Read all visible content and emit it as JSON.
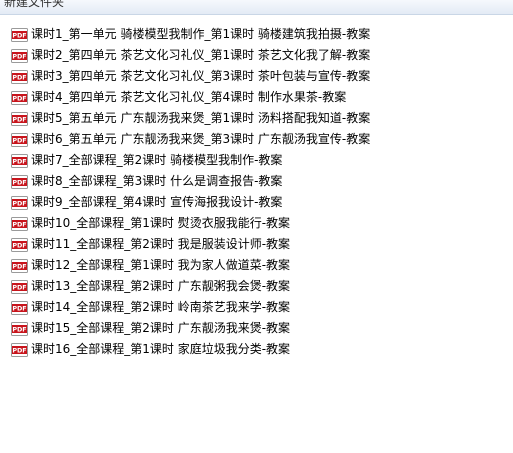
{
  "window": {
    "header_label": "新建文件夹"
  },
  "icons": {
    "file_icon": "pdf-icon",
    "pdf_badge_text": "PDF",
    "pdf_badge_color": "#c8141c"
  },
  "files": [
    {
      "name": "课时1_第一单元 骑楼模型我制作_第1课时 骑楼建筑我拍摄-教案"
    },
    {
      "name": "课时2_第四单元 茶艺文化习礼仪_第1课时 茶艺文化我了解-教案"
    },
    {
      "name": "课时3_第四单元 茶艺文化习礼仪_第3课时 茶叶包装与宣传-教案"
    },
    {
      "name": "课时4_第四单元 茶艺文化习礼仪_第4课时 制作水果茶-教案"
    },
    {
      "name": "课时5_第五单元 广东靓汤我来煲_第1课时 汤料搭配我知道-教案"
    },
    {
      "name": "课时6_第五单元 广东靓汤我来煲_第3课时 广东靓汤我宣传-教案"
    },
    {
      "name": "课时7_全部课程_第2课时 骑楼模型我制作-教案"
    },
    {
      "name": "课时8_全部课程_第3课时 什么是调查报告-教案"
    },
    {
      "name": "课时9_全部课程_第4课时 宣传海报我设计-教案"
    },
    {
      "name": "课时10_全部课程_第1课时 熨烫衣服我能行-教案"
    },
    {
      "name": "课时11_全部课程_第2课时 我是服装设计师-教案"
    },
    {
      "name": "课时12_全部课程_第1课时 我为家人做道菜-教案"
    },
    {
      "name": "课时13_全部课程_第2课时 广东靓粥我会煲-教案"
    },
    {
      "name": "课时14_全部课程_第2课时 岭南茶艺我来学-教案"
    },
    {
      "name": "课时15_全部课程_第2课时 广东靓汤我来煲-教案"
    },
    {
      "name": "课时16_全部课程_第1课时 家庭垃圾我分类-教案"
    }
  ]
}
